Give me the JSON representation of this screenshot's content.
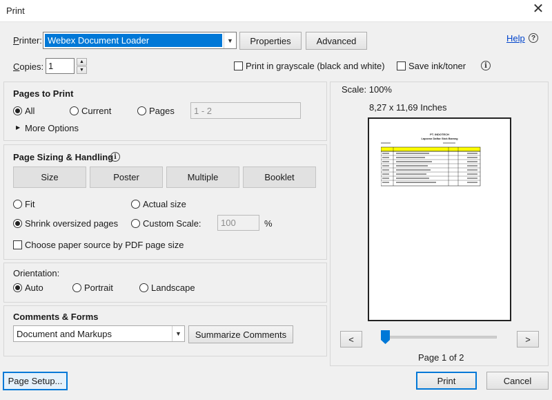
{
  "window": {
    "title": "Print",
    "close_glyph": "✕"
  },
  "printer": {
    "label": "Printer:",
    "selected": "Webex Document Loader",
    "properties_label": "Properties",
    "advanced_label": "Advanced",
    "help_label": "Help",
    "help_glyph": "?"
  },
  "copies": {
    "label": "Copies:",
    "value": "1",
    "grayscale_label": "Print in grayscale (black and white)",
    "save_ink_label": "Save ink/toner",
    "info_glyph": "i"
  },
  "pages_to_print": {
    "heading": "Pages to Print",
    "all_label": "All",
    "current_label": "Current",
    "pages_label": "Pages",
    "pages_range": "1 - 2",
    "more_options_label": "More Options",
    "selected": "All"
  },
  "sizing": {
    "heading": "Page Sizing & Handling",
    "buttons": [
      "Size",
      "Poster",
      "Multiple",
      "Booklet"
    ],
    "fit_label": "Fit",
    "actual_size_label": "Actual size",
    "shrink_label": "Shrink oversized pages",
    "custom_scale_label": "Custom Scale:",
    "custom_scale_value": "100",
    "percent": "%",
    "paper_source_label": "Choose paper source by PDF page size",
    "selected": "Shrink oversized pages"
  },
  "orientation": {
    "heading": "Orientation:",
    "auto_label": "Auto",
    "portrait_label": "Portrait",
    "landscape_label": "Landscape",
    "selected": "Auto"
  },
  "comments": {
    "heading": "Comments & Forms",
    "selected": "Document and Markups",
    "summarize_label": "Summarize Comments"
  },
  "preview": {
    "scale": "Scale: 100%",
    "dimensions": "8,27 x 11,69 Inches",
    "doc_title_1": "PT. INDOTECH",
    "doc_title_2": "Laporan Daftar Stok Barang",
    "page_info": "Page 1 of 2",
    "prev_glyph": "<",
    "next_glyph": ">",
    "slider_position": 0
  },
  "footer": {
    "page_setup_label": "Page Setup...",
    "print_label": "Print",
    "cancel_label": "Cancel"
  },
  "colors": {
    "accent": "#0078d7",
    "link": "#0044cc",
    "selection_bg": "#0078d7",
    "table_header": "#ffff00"
  }
}
